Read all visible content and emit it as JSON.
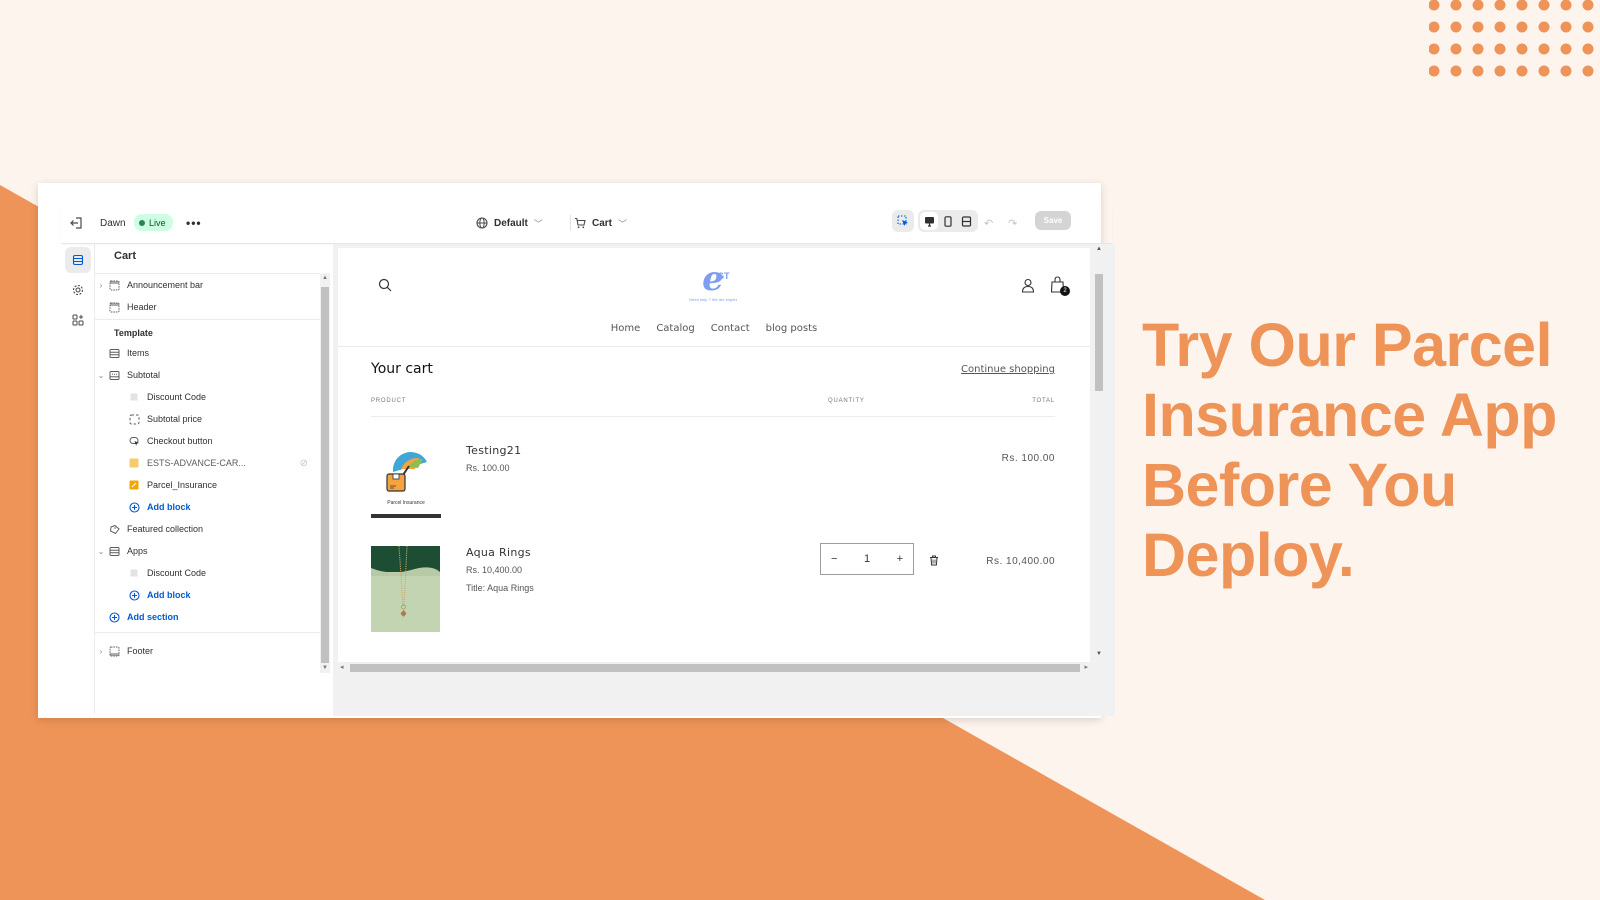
{
  "colors": {
    "accent_orange": "#ef9458",
    "background_cream": "#fdf4ee",
    "live_green": "#29845a",
    "link_blue": "#005bd3",
    "logo_blue": "#7e9ef2"
  },
  "hero": {
    "lines": [
      "Try Our Parcel",
      "Insurance App",
      "Before You",
      "Deploy."
    ]
  },
  "editor": {
    "topbar": {
      "exit_icon": "exit-icon",
      "theme_name": "Dawn",
      "live_badge": "Live",
      "more_label": "•••",
      "market_label": "Default",
      "page_label": "Cart",
      "undo_label": "↶",
      "redo_label": "↷",
      "save_label": "Save"
    },
    "rail": [
      "sections-icon",
      "settings-icon",
      "apps-icon"
    ],
    "sidebar": {
      "title": "Cart",
      "header_group": [
        {
          "label": "Announcement bar",
          "expandable": true
        },
        {
          "label": "Header",
          "expandable": false
        }
      ],
      "template_label": "Template",
      "template_items": [
        {
          "label": "Items"
        },
        {
          "label": "Subtotal",
          "expanded": true
        },
        {
          "label": "Discount Code"
        },
        {
          "label": "Subtotal price"
        },
        {
          "label": "Checkout button"
        },
        {
          "label": "ESTS-ADVANCE-CAR...",
          "hidden": true
        },
        {
          "label": "Parcel_Insurance"
        },
        {
          "label": "Add block"
        },
        {
          "label": "Featured collection"
        },
        {
          "label": "Apps",
          "expanded": true
        },
        {
          "label": "Discount Code"
        },
        {
          "label": "Add block"
        },
        {
          "label": "Add section"
        }
      ],
      "footer_group": [
        {
          "label": "Footer",
          "expandable": true
        }
      ],
      "hidden_icon": "⊘"
    },
    "preview": {
      "logo_text": "e",
      "logo_suffix": "ST",
      "logo_tagline": "Need help ? We are expert",
      "cart_count": "2",
      "nav": [
        "Home",
        "Catalog",
        "Contact",
        "blog posts"
      ],
      "cart_title": "Your cart",
      "continue_label": "Continue shopping",
      "columns": {
        "product": "PRODUCT",
        "quantity": "QUANTITY",
        "total": "TOTAL"
      },
      "items": [
        {
          "name": "Testing21",
          "price": "Rs. 100.00",
          "option": "",
          "quantity": null,
          "total": "Rs. 100.00",
          "image_caption": "Parcel Insurance"
        },
        {
          "name": "Aqua Rings",
          "price": "Rs. 10,400.00",
          "option": "Title: Aqua Rings",
          "quantity": "1",
          "total": "Rs. 10,400.00"
        }
      ],
      "qty_minus": "−",
      "qty_plus": "+"
    }
  }
}
